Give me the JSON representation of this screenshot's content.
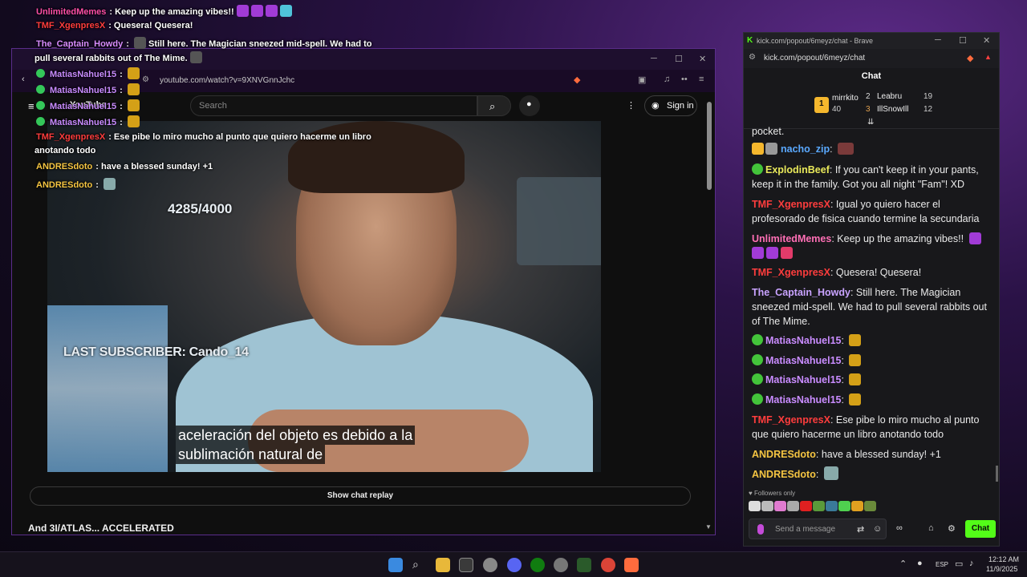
{
  "overlay_chat": [
    {
      "user": "UnlimitedMemes",
      "color": "#ff4fa8",
      "text": "Keep up the amazing vibes!!"
    },
    {
      "user": "TMF_XgenpresX",
      "color": "#ff3d3d",
      "text": "Quesera! Quesera!"
    },
    {
      "user": "The_Captain_Howdy",
      "color": "#d98cff",
      "text": "Still here. The Magician sneezed mid-spell. We had to"
    },
    {
      "user": "",
      "color": "#ffffff",
      "text": "pull several rabbits out of The Mime."
    },
    {
      "user": "MatiasNahuel15",
      "color": "#c98cff",
      "text": ""
    },
    {
      "user": "MatiasNahuel15",
      "color": "#c98cff",
      "text": ""
    },
    {
      "user": "MatiasNahuel15",
      "color": "#c98cff",
      "text": ""
    },
    {
      "user": "MatiasNahuel15",
      "color": "#c98cff",
      "text": ""
    },
    {
      "user": "TMF_XgenpresX",
      "color": "#ff3d3d",
      "text": "Ese pibe lo miro mucho al punto que quiero hacerme un libro"
    },
    {
      "user": "",
      "color": "#ffffff",
      "text": "anotando todo"
    },
    {
      "user": "ANDRESdoto",
      "color": "#f5c542",
      "text": "have a blessed sunday! +1"
    },
    {
      "user": "ANDRESdoto",
      "color": "#f5c542",
      "text": ""
    }
  ],
  "youtube": {
    "url": "youtube.com/watch?v=9XNVGnnJchc",
    "logo_text": "YouTube",
    "search_placeholder": "Search",
    "sign_in": "Sign in",
    "counter": "4285/4000",
    "last_subscriber": "LAST SUBSCRIBER: Cando_14",
    "subtitle_line1": "aceleración del objeto es debido a la",
    "subtitle_line2": "sublimación natural de",
    "show_chat_replay": "Show chat replay",
    "video_title": "And 3I/ATLAS... ACCELERATED"
  },
  "kick": {
    "window_title": "kick.com/popout/6meyz/chat - Brave",
    "url": "kick.com/popout/6meyz/chat",
    "chat_title": "Chat",
    "leaders": [
      {
        "rank": "1",
        "name": "mirrkito",
        "count": "40"
      },
      {
        "rank": "2",
        "name": "Leabru",
        "count": "19"
      },
      {
        "rank": "3",
        "name": "IllSnowIll",
        "count": "12"
      }
    ],
    "messages": [
      {
        "user": "",
        "color": "#eaeaea",
        "text": "pocket."
      },
      {
        "user": "nacho_zip",
        "color": "#5aa9ff",
        "text": ""
      },
      {
        "user": "ExplodinBeef",
        "color": "#e9e95a",
        "text": "If you can't keep it in your pants, keep it in the family. Got you all night \"Fam\"! XD"
      },
      {
        "user": "TMF_XgenpresX",
        "color": "#ff3d3d",
        "text": "Igual yo quiero hacer el profesorado de fisica cuando termine la secundaria"
      },
      {
        "user": "UnlimitedMemes",
        "color": "#ff6fb5",
        "text": "Keep up the amazing vibes!!"
      },
      {
        "user": "TMF_XgenpresX",
        "color": "#ff3d3d",
        "text": "Quesera! Quesera!"
      },
      {
        "user": "The_Captain_Howdy",
        "color": "#c9a3ff",
        "text": "Still here. The Magician sneezed mid-spell. We had to pull several rabbits out of The Mime."
      },
      {
        "user": "MatiasNahuel15",
        "color": "#c98cff",
        "text": ""
      },
      {
        "user": "MatiasNahuel15",
        "color": "#c98cff",
        "text": ""
      },
      {
        "user": "MatiasNahuel15",
        "color": "#c98cff",
        "text": ""
      },
      {
        "user": "MatiasNahuel15",
        "color": "#c98cff",
        "text": ""
      },
      {
        "user": "TMF_XgenpresX",
        "color": "#ff3d3d",
        "text": "Ese pibe lo miro mucho al punto que quiero hacerme un libro anotando todo"
      },
      {
        "user": "ANDRESdoto",
        "color": "#f5c542",
        "text": "have a blessed sunday! +1"
      },
      {
        "user": "ANDRESdoto",
        "color": "#f5c542",
        "text": ""
      }
    ],
    "followers_only": "Followers only",
    "send_placeholder": "Send a message",
    "chat_button": "Chat"
  },
  "taskbar": {
    "language": "ESP",
    "time": "12:12 AM",
    "date": "11/9/2025"
  }
}
